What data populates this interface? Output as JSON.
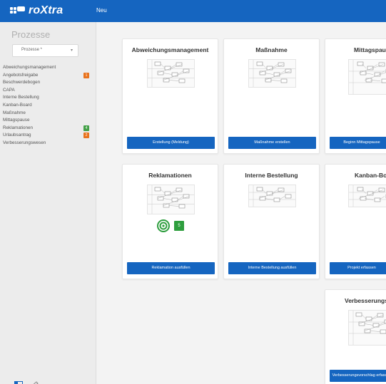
{
  "app": {
    "logo_text": "roXtra",
    "new_label": "Neu"
  },
  "sidebar": {
    "title": "Prozesse",
    "select_value": "Prozesse *",
    "items": [
      {
        "label": "Abweichungsmanagement"
      },
      {
        "label": "Angebotsfreigabe",
        "badge": "1",
        "badge_color": "#e8731d"
      },
      {
        "label": "Beschwerdebogen"
      },
      {
        "label": "CAPA"
      },
      {
        "label": "Interne Bestellung"
      },
      {
        "label": "Kanban-Board"
      },
      {
        "label": "Maßnahme"
      },
      {
        "label": "Mittagspause"
      },
      {
        "label": "Reklamationen",
        "badge": "4",
        "badge_color": "#43a047"
      },
      {
        "label": "Urlaubsantrag",
        "badge": "2",
        "badge_color": "#e8731d"
      },
      {
        "label": "Verbesserungswesen"
      }
    ]
  },
  "cards": [
    {
      "title": "Abweichungsmanagement",
      "button": "Erstellung (Meldung)"
    },
    {
      "title": "Maßnahme",
      "button": "Maßnahme erstellen"
    },
    {
      "title": "Mittagspause",
      "button": "Beginn Mittagspause"
    },
    {
      "title": "Reklamationen",
      "button": "Reklamation ausfüllen",
      "status_count": "5"
    },
    {
      "title": "Interne Bestellung",
      "button": "Interne Bestellung ausfüllen"
    },
    {
      "title": "Kanban-Board",
      "button": "Projekt erfassen"
    },
    {
      "title": "Verbesserungswesen",
      "button": "Verbesserungsvorschlag erfassen"
    }
  ],
  "colors": {
    "primary": "#1565c0",
    "badge_orange": "#e8731d",
    "badge_green": "#43a047",
    "status_green": "#2e9e3e"
  }
}
